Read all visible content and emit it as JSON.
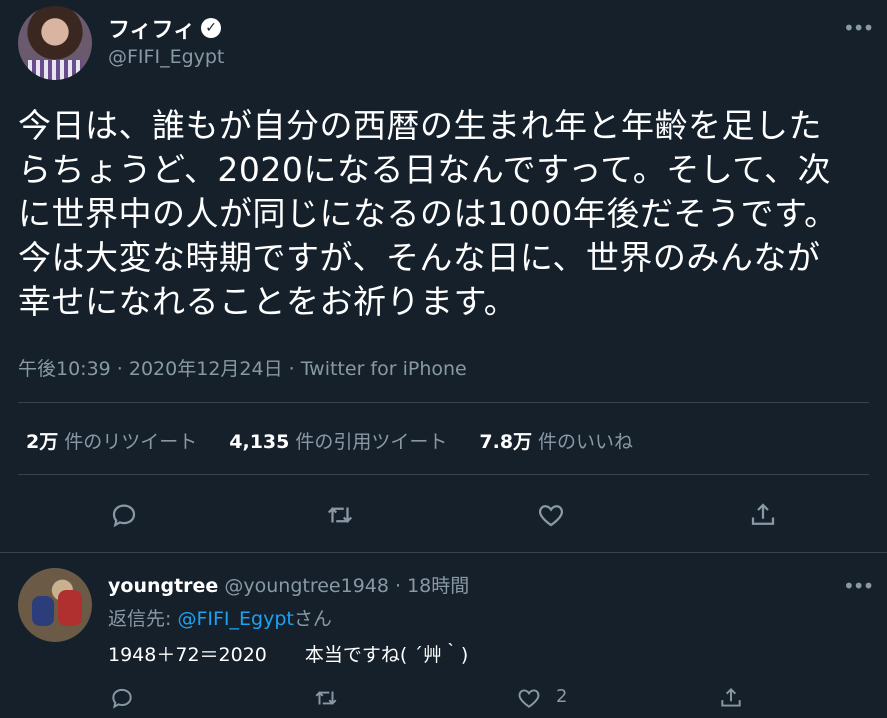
{
  "tweet": {
    "display_name": "フィフィ",
    "handle": "@FIFI_Egypt",
    "text_lines": [
      "今日は、誰もが自分の西暦の生まれ年と年齢を足した",
      "らちょうど、2020になる日なんですって。そして、次",
      "に世界中の人が同じになるのは1000年後だそうです。",
      "今は大変な時期ですが、そんな日に、世界のみんなが",
      "幸せになれることをお祈ります。"
    ],
    "meta": "午後10:39 · 2020年12月24日 · Twitter for iPhone",
    "stats": {
      "retweets_value": "2万",
      "retweets_label": "件のリツイート",
      "quotes_value": "4,135",
      "quotes_label": "件の引用ツイート",
      "likes_value": "7.8万",
      "likes_label": "件のいいね"
    }
  },
  "reply": {
    "display_name": "youngtree",
    "handle_time": "@youngtree1948 · 18時間",
    "replying_prefix": "返信先: ",
    "replying_handle": "@FIFI_Egypt",
    "replying_suffix": "さん",
    "text": "1948＋72＝2020　　本当ですね( ´艸｀)",
    "like_count": "2"
  },
  "colors": {
    "background": "#15202b",
    "secondary_text": "#8899a6",
    "link": "#1da1f2",
    "divider": "#38444d"
  },
  "icons": [
    "verified-badge-icon",
    "more-icon",
    "reply-icon",
    "retweet-icon",
    "like-icon",
    "share-icon"
  ]
}
